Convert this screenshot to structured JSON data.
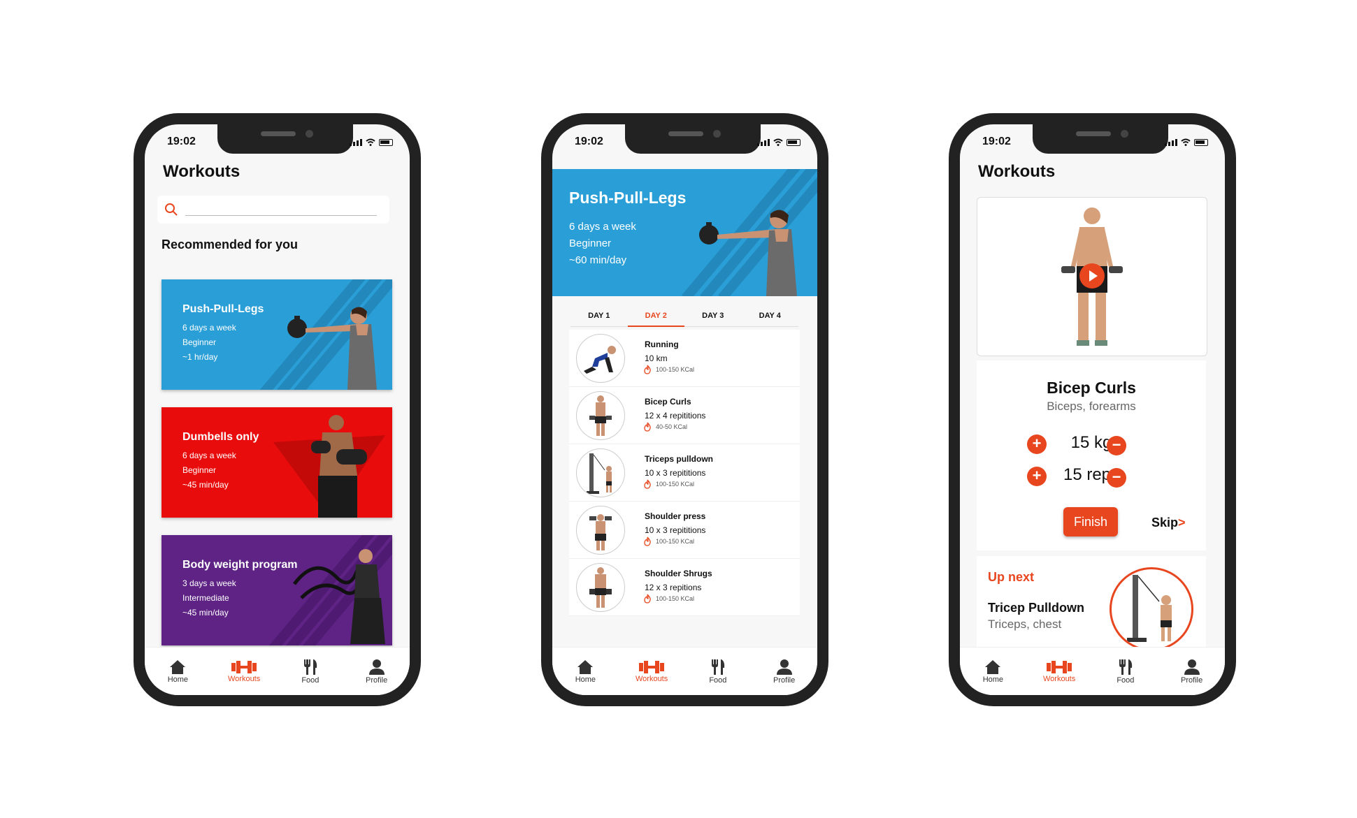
{
  "status": {
    "time": "19:02"
  },
  "tabbar": {
    "items": [
      "Home",
      "Workouts",
      "Food",
      "Profile"
    ],
    "active": "Workouts"
  },
  "screen1": {
    "title": "Workouts",
    "search": {
      "placeholder": ""
    },
    "section_title": "Recommended for you",
    "cards": [
      {
        "title": "Push-Pull-Legs",
        "lines": [
          "6 days a week",
          "Beginner",
          "~1 hr/day"
        ],
        "color": "#2a9ed6"
      },
      {
        "title": "Dumbells only",
        "lines": [
          "6 days a week",
          "Beginner",
          "~45 min/day"
        ],
        "color": "#e80c0c"
      },
      {
        "title": "Body weight program",
        "lines": [
          "3 days a week",
          "Intermediate",
          "~45 min/day"
        ],
        "color": "#5e2385"
      }
    ]
  },
  "screen2": {
    "hero": {
      "title": "Push-Pull-Legs",
      "lines": [
        "6 days a week",
        "Beginner",
        "~60 min/day"
      ]
    },
    "days": [
      "DAY 1",
      "DAY 2",
      "DAY 3",
      "DAY 4"
    ],
    "active_day": "DAY 2",
    "exercises": [
      {
        "name": "Running",
        "reps": "10 km",
        "kcal": "100-150 KCal",
        "icon": "runner-icon"
      },
      {
        "name": "Bicep Curls",
        "reps": "12 x 4 repititions",
        "kcal": "40-50 KCal",
        "icon": "dumbbell-man-icon"
      },
      {
        "name": "Triceps pulldown",
        "reps": "10 x 3 repititions",
        "kcal": "100-150 KCal",
        "icon": "cable-machine-icon"
      },
      {
        "name": "Shoulder press",
        "reps": "10 x 3 repititions",
        "kcal": "100-150 KCal",
        "icon": "press-man-icon"
      },
      {
        "name": "Shoulder Shrugs",
        "reps": "12 x 3 repitions",
        "kcal": "100-150 KCal",
        "icon": "shrug-man-icon"
      }
    ]
  },
  "screen3": {
    "title": "Workouts",
    "exercise": {
      "name": "Bicep Curls",
      "muscles": "Biceps, forearms"
    },
    "weight": "15 kg",
    "reps": "15 reps",
    "finish_label": "Finish",
    "skip_label": "Skip",
    "skip_arrow": ">",
    "up_next": {
      "label": "Up next",
      "name": "Tricep Pulldown",
      "muscles": "Triceps, chest"
    }
  },
  "colors": {
    "accent": "#e8461e",
    "blue": "#2a9ed6",
    "red": "#e80c0c",
    "purple": "#5e2385"
  }
}
